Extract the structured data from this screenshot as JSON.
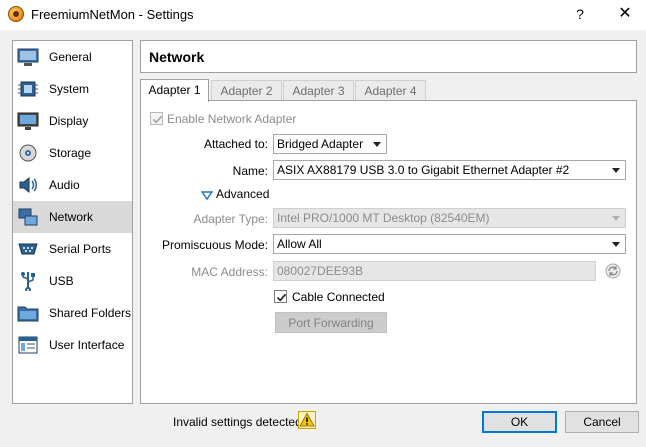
{
  "window": {
    "title": "FreemiumNetMon - Settings",
    "help": "?",
    "close": "✕"
  },
  "sidebar": {
    "items": [
      {
        "label": "General",
        "icon": "general-icon"
      },
      {
        "label": "System",
        "icon": "system-icon"
      },
      {
        "label": "Display",
        "icon": "display-icon"
      },
      {
        "label": "Storage",
        "icon": "storage-icon"
      },
      {
        "label": "Audio",
        "icon": "audio-icon"
      },
      {
        "label": "Network",
        "icon": "network-icon",
        "selected": true
      },
      {
        "label": "Serial Ports",
        "icon": "serial-ports-icon"
      },
      {
        "label": "USB",
        "icon": "usb-icon"
      },
      {
        "label": "Shared Folders",
        "icon": "shared-folders-icon"
      },
      {
        "label": "User Interface",
        "icon": "user-interface-icon"
      }
    ]
  },
  "page": {
    "title": "Network"
  },
  "tabs": [
    "Adapter 1",
    "Adapter 2",
    "Adapter 3",
    "Adapter 4"
  ],
  "form": {
    "enable_adapter": "Enable Network Adapter",
    "attached_label": "Attached to:",
    "attached_value": "Bridged Adapter",
    "name_label": "Name:",
    "name_value": "ASIX AX88179 USB 3.0 to Gigabit Ethernet Adapter #2",
    "advanced": "Advanced",
    "adapter_type_label": "Adapter Type:",
    "adapter_type_value": "Intel PRO/1000 MT Desktop (82540EM)",
    "promisc_label": "Promiscuous Mode:",
    "promisc_value": "Allow All",
    "mac_label": "MAC Address:",
    "mac_value": "080027DEE93B",
    "cable": "Cable Connected",
    "port_forwarding": "Port Forwarding"
  },
  "footer": {
    "warning": "Invalid settings detected",
    "ok": "OK",
    "cancel": "Cancel"
  },
  "colors": {
    "accent": "#0078d7",
    "selected_bg": "#d9d9d9",
    "warning_icon": "#f5c400"
  }
}
